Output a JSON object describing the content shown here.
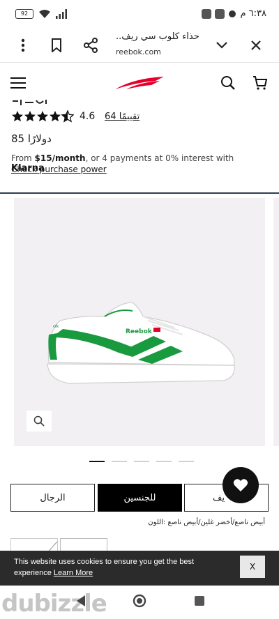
{
  "status_bar": {
    "battery": "92",
    "time": "٦:٣٨ م"
  },
  "browser": {
    "page_title": "حذاء كلوب سي ريف..",
    "url": "reebok.com"
  },
  "header": {
    "logo_icon": "reebok-logo",
    "menu_icon": "hamburger-icon",
    "search_icon": "search-icon",
    "cart_icon": "cart-icon"
  },
  "product": {
    "rating_value": "4.6",
    "stars": "★★★★★",
    "review_count": "64 تقييمًا",
    "price": "85 دولارًا",
    "klarna": {
      "from": "From ",
      "amount": "$15/month",
      "rest": ", or 4 payments at 0% interest with ",
      "brand": "Klarna",
      "link": "Check purchase power"
    },
    "gallery_dots": 5,
    "gallery_active": 0
  },
  "genders": {
    "men": "الرجال",
    "unisex": "للجنسين",
    "partial": "يف"
  },
  "color": {
    "label": "أبيض ناصع/أخضر غلين/أبيض ناصع :اللون"
  },
  "cookie": {
    "text": "This website uses cookies to ensure you get the best experience ",
    "link": "Learn More",
    "close": "X"
  },
  "watermark": "dubizzle",
  "colors": {
    "accent_green": "#1a9a3f",
    "reebok_red": "#e4002b",
    "divider": "#2c3e50"
  }
}
